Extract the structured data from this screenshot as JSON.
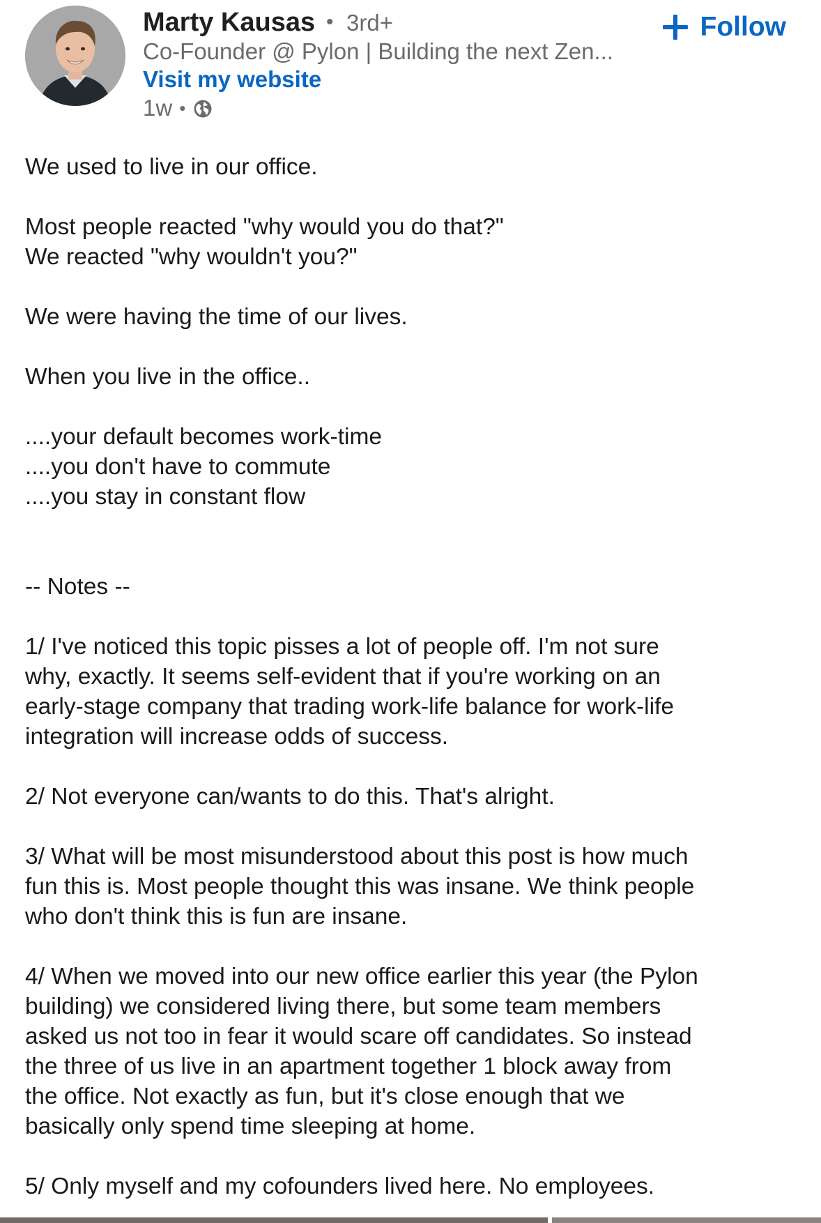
{
  "author": {
    "name": "Marty Kausas",
    "degree": "3rd+",
    "separator": "•",
    "headline": "Co-Founder @ Pylon | Building the next Zen...",
    "website_label": "Visit my website",
    "posted_ago": "1w",
    "meta_separator": "•"
  },
  "actions": {
    "follow_label": "Follow"
  },
  "icons": {
    "avatar": "avatar-photo",
    "visibility": "globe-icon",
    "follow": "plus-icon"
  },
  "colors": {
    "accent": "#0a66c2",
    "secondary_text": "#6b6b6b",
    "body_text": "#1a1a1a"
  },
  "post": {
    "lines": [
      "We used to live in our office.",
      "Most people reacted \"why would you do that?\"",
      "We reacted \"why wouldn't you?\"",
      "We were having the time of our lives.",
      "When you live in the office..",
      "....your default becomes work-time",
      "....you don't have to commute",
      "....you stay in constant flow",
      "-- Notes --",
      "1/ I've noticed this topic pisses a lot of people off. I'm not sure",
      "why, exactly. It seems self-evident that if you're working on an",
      "early-stage company that trading work-life balance for work-life",
      "integration will increase odds of success.",
      "2/ Not everyone can/wants to do this. That's alright.",
      "3/ What will be most misunderstood about this post is how much",
      "fun this is. Most people thought this was insane. We think people",
      "who don't think this is fun are insane.",
      "4/ When we moved into our new office earlier this year (the Pylon",
      "building) we considered living there, but some team members",
      "asked us not too in fear it would scare off candidates. So instead",
      "the three of us live in an apartment together 1 block away from",
      "the office. Not exactly as fun, but it's close enough that we",
      "basically only spend time sleeping at home.",
      "5/ Only myself and my cofounders lived here. No employees."
    ]
  }
}
